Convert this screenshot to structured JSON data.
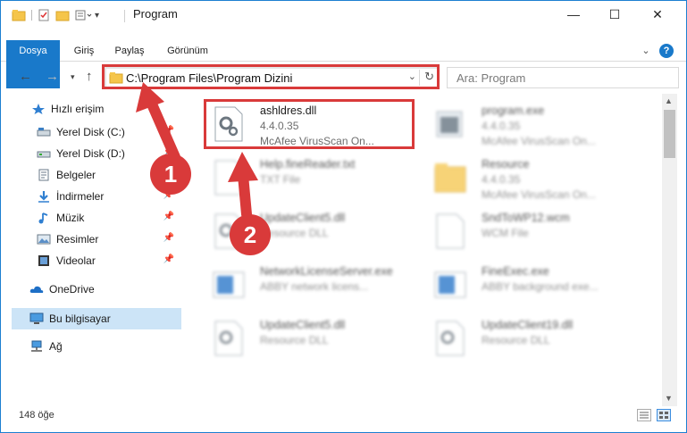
{
  "window": {
    "title": "Program",
    "minimize": "—",
    "maximize": "☐",
    "close": "✕"
  },
  "ribbon": {
    "tabs": [
      "Dosya",
      "Giriş",
      "Paylaş",
      "Görünüm"
    ],
    "help": "?",
    "expand": "⌄"
  },
  "address": {
    "path": "C:\\Program Files\\Program Dizini",
    "dropdown": "⌄",
    "refresh": "↻"
  },
  "search": {
    "placeholder": "Ara: Program"
  },
  "sidebar": {
    "quick_access": "Hızlı erişim",
    "items": [
      {
        "label": "Yerel Disk (C:)",
        "icon": "drive-icon",
        "pinned": true
      },
      {
        "label": "Yerel Disk (D:)",
        "icon": "drive-icon",
        "pinned": true
      },
      {
        "label": "Belgeler",
        "icon": "documents-icon",
        "pinned": true
      },
      {
        "label": "İndirmeler",
        "icon": "downloads-icon",
        "pinned": true
      },
      {
        "label": "Müzik",
        "icon": "music-icon",
        "pinned": true
      },
      {
        "label": "Resimler",
        "icon": "pictures-icon",
        "pinned": true
      },
      {
        "label": "Videolar",
        "icon": "videos-icon",
        "pinned": true
      }
    ],
    "onedrive": "OneDrive",
    "this_pc": "Bu bilgisayar",
    "network": "Ağ"
  },
  "files": [
    {
      "name": "ashldres.dll",
      "line2": "4.4.0.35",
      "line3": "McAfee VirusScan On...",
      "highlight": true
    },
    {
      "name": "program.exe",
      "line2": "4.4.0.35",
      "line3": "McAfee VirusScan On..."
    },
    {
      "name": "Help.fineReader.txt",
      "line2": "TXT File",
      "line3": ""
    },
    {
      "name": "Resource",
      "line2": "4.4.0.35",
      "line3": "McAfee VirusScan On..."
    },
    {
      "name": "UpdateClient5.dll",
      "line2": "Resource DLL",
      "line3": ""
    },
    {
      "name": "SndToWP12.wcm",
      "line2": "WCM File",
      "line3": ""
    },
    {
      "name": "NetworkLicenseServer.exe",
      "line2": "ABBY network licens...",
      "line3": ""
    },
    {
      "name": "FineExec.exe",
      "line2": "ABBY background exe...",
      "line3": ""
    },
    {
      "name": "UpdateClient5.dll",
      "line2": "Resource DLL",
      "line3": ""
    },
    {
      "name": "UpdateClient19.dll",
      "line2": "Resource DLL",
      "line3": ""
    }
  ],
  "status": {
    "count": "148 öğe"
  },
  "annotations": {
    "step1": "1",
    "step2": "2"
  },
  "colors": {
    "accent": "#1979ca",
    "annotation": "#d93a3a",
    "selected": "#cce4f7"
  }
}
